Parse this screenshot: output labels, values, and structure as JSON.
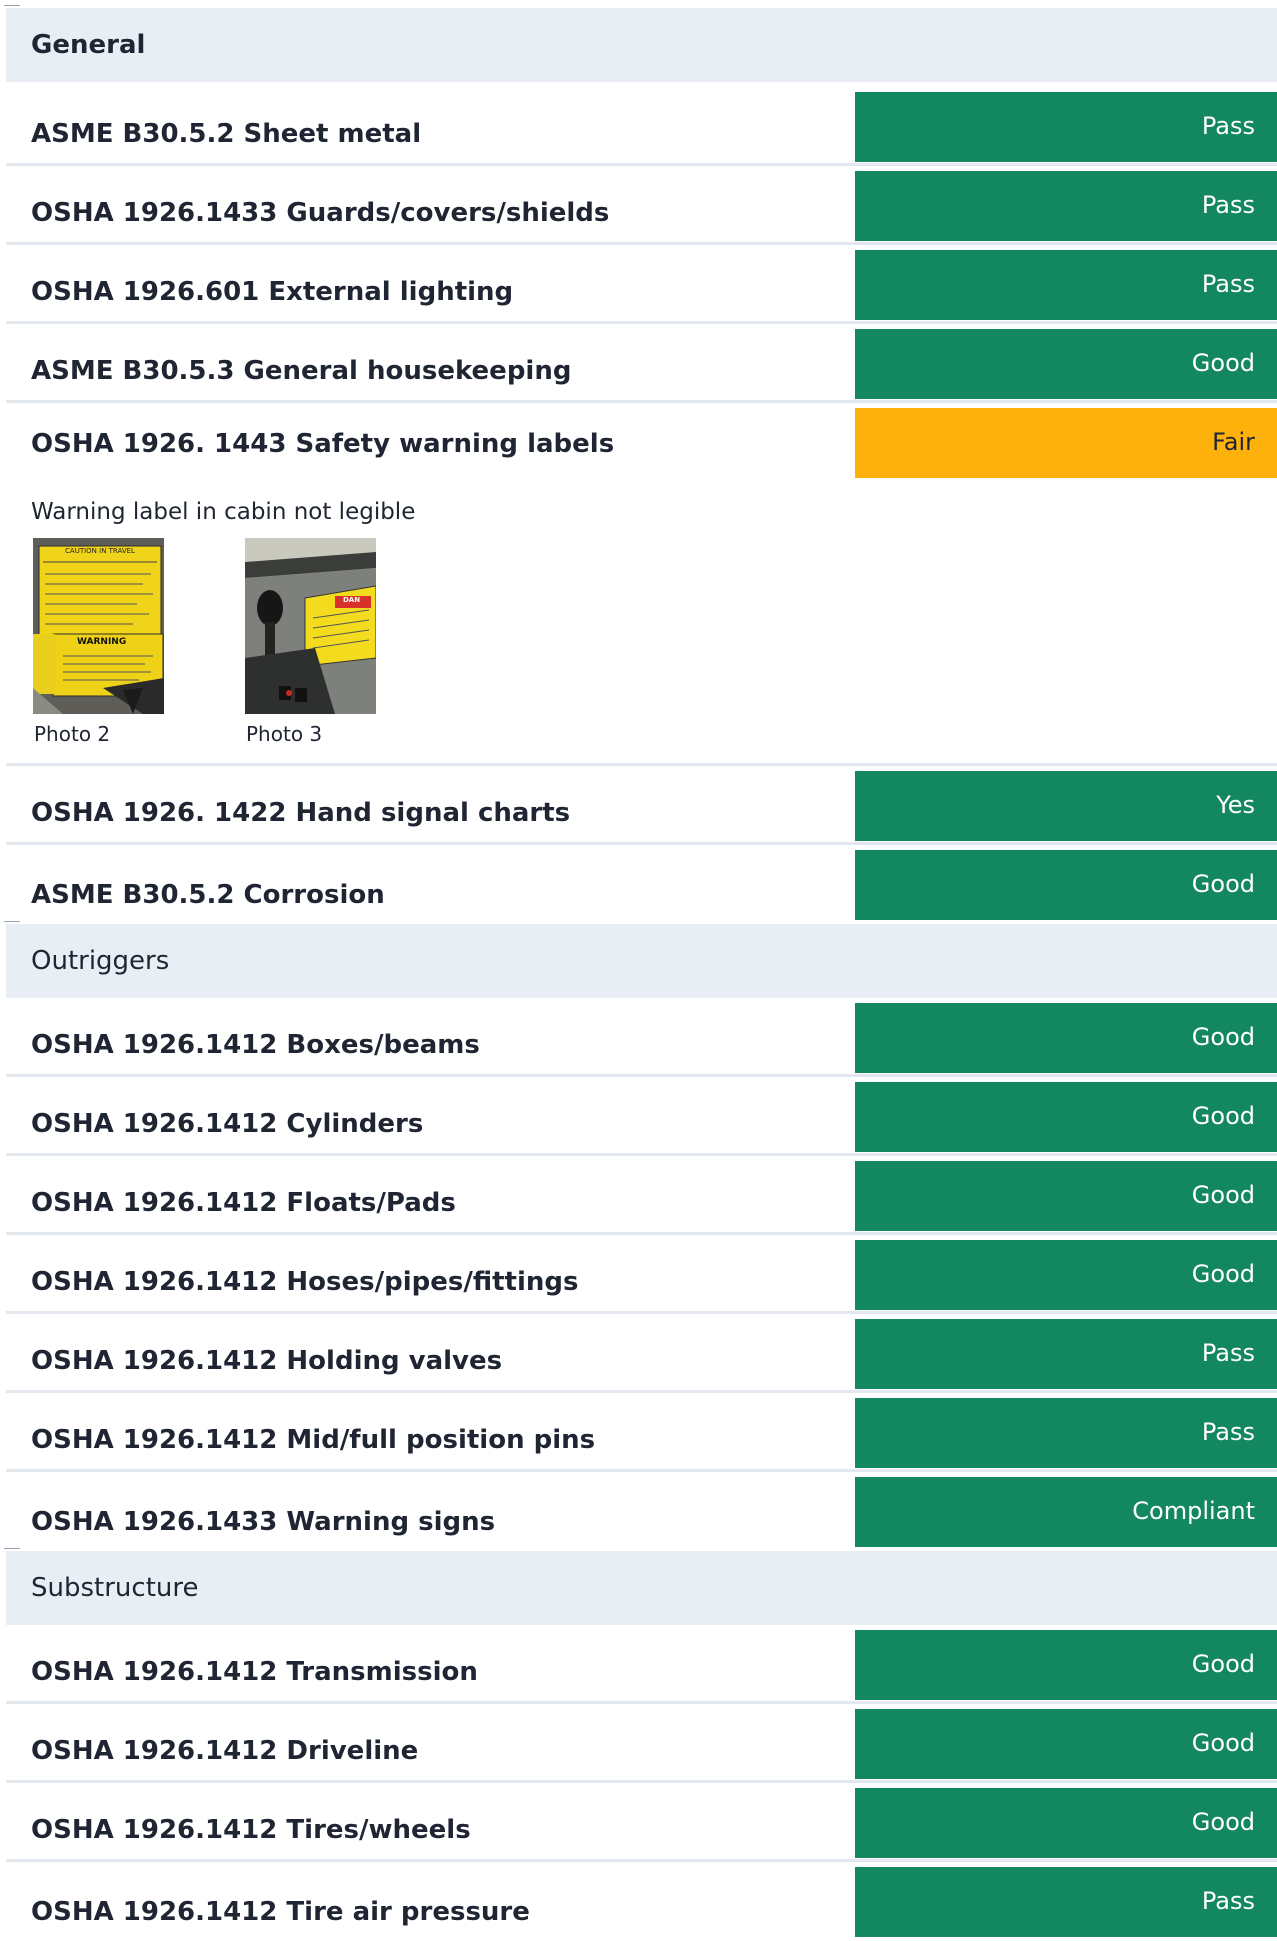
{
  "sections": [
    {
      "title": "General",
      "rows": [
        {
          "label": "ASME B30.5.2 Sheet metal",
          "status": "Pass"
        },
        {
          "label": "OSHA 1926.1433 Guards/covers/shields",
          "status": "Pass"
        },
        {
          "label": "OSHA 1926.601 External lighting",
          "status": "Pass"
        },
        {
          "label": "ASME B30.5.3 General housekeeping",
          "status": "Good"
        },
        {
          "label": "OSHA 1926. 1443 Safety warning labels",
          "status": "Fair",
          "note": "Warning label in cabin not legible",
          "photos": [
            {
              "caption": "Photo 2"
            },
            {
              "caption": "Photo 3"
            }
          ]
        },
        {
          "label": "OSHA 1926. 1422 Hand signal charts",
          "status": "Yes"
        },
        {
          "label": "ASME B30.5.2 Corrosion",
          "status": "Good"
        }
      ]
    },
    {
      "title": "Outriggers",
      "rows": [
        {
          "label": "OSHA 1926.1412 Boxes/beams",
          "status": "Good"
        },
        {
          "label": "OSHA 1926.1412 Cylinders",
          "status": "Good"
        },
        {
          "label": "OSHA 1926.1412 Floats/Pads",
          "status": "Good"
        },
        {
          "label": "OSHA 1926.1412 Hoses/pipes/fittings",
          "status": "Good"
        },
        {
          "label": "OSHA 1926.1412 Holding valves",
          "status": "Pass"
        },
        {
          "label": "OSHA 1926.1412 Mid/full position pins",
          "status": "Pass"
        },
        {
          "label": "OSHA 1926.1433 Warning signs",
          "status": "Compliant"
        }
      ]
    },
    {
      "title": "Substructure",
      "rows": [
        {
          "label": "OSHA 1926.1412 Transmission",
          "status": "Good"
        },
        {
          "label": "OSHA 1926.1412 Driveline",
          "status": "Good"
        },
        {
          "label": "OSHA 1926.1412 Tires/wheels",
          "status": "Good"
        },
        {
          "label": "OSHA 1926.1412 Tire air pressure",
          "status": "Pass"
        }
      ]
    }
  ],
  "photo_sticker_text": {
    "caution": "CAUTION IN TRAVEL",
    "warning": "WARNING",
    "danger": "DAN"
  },
  "colors": {
    "good": "#138760",
    "fair": "#fdb10a",
    "header_bg": "#e9eef5"
  }
}
